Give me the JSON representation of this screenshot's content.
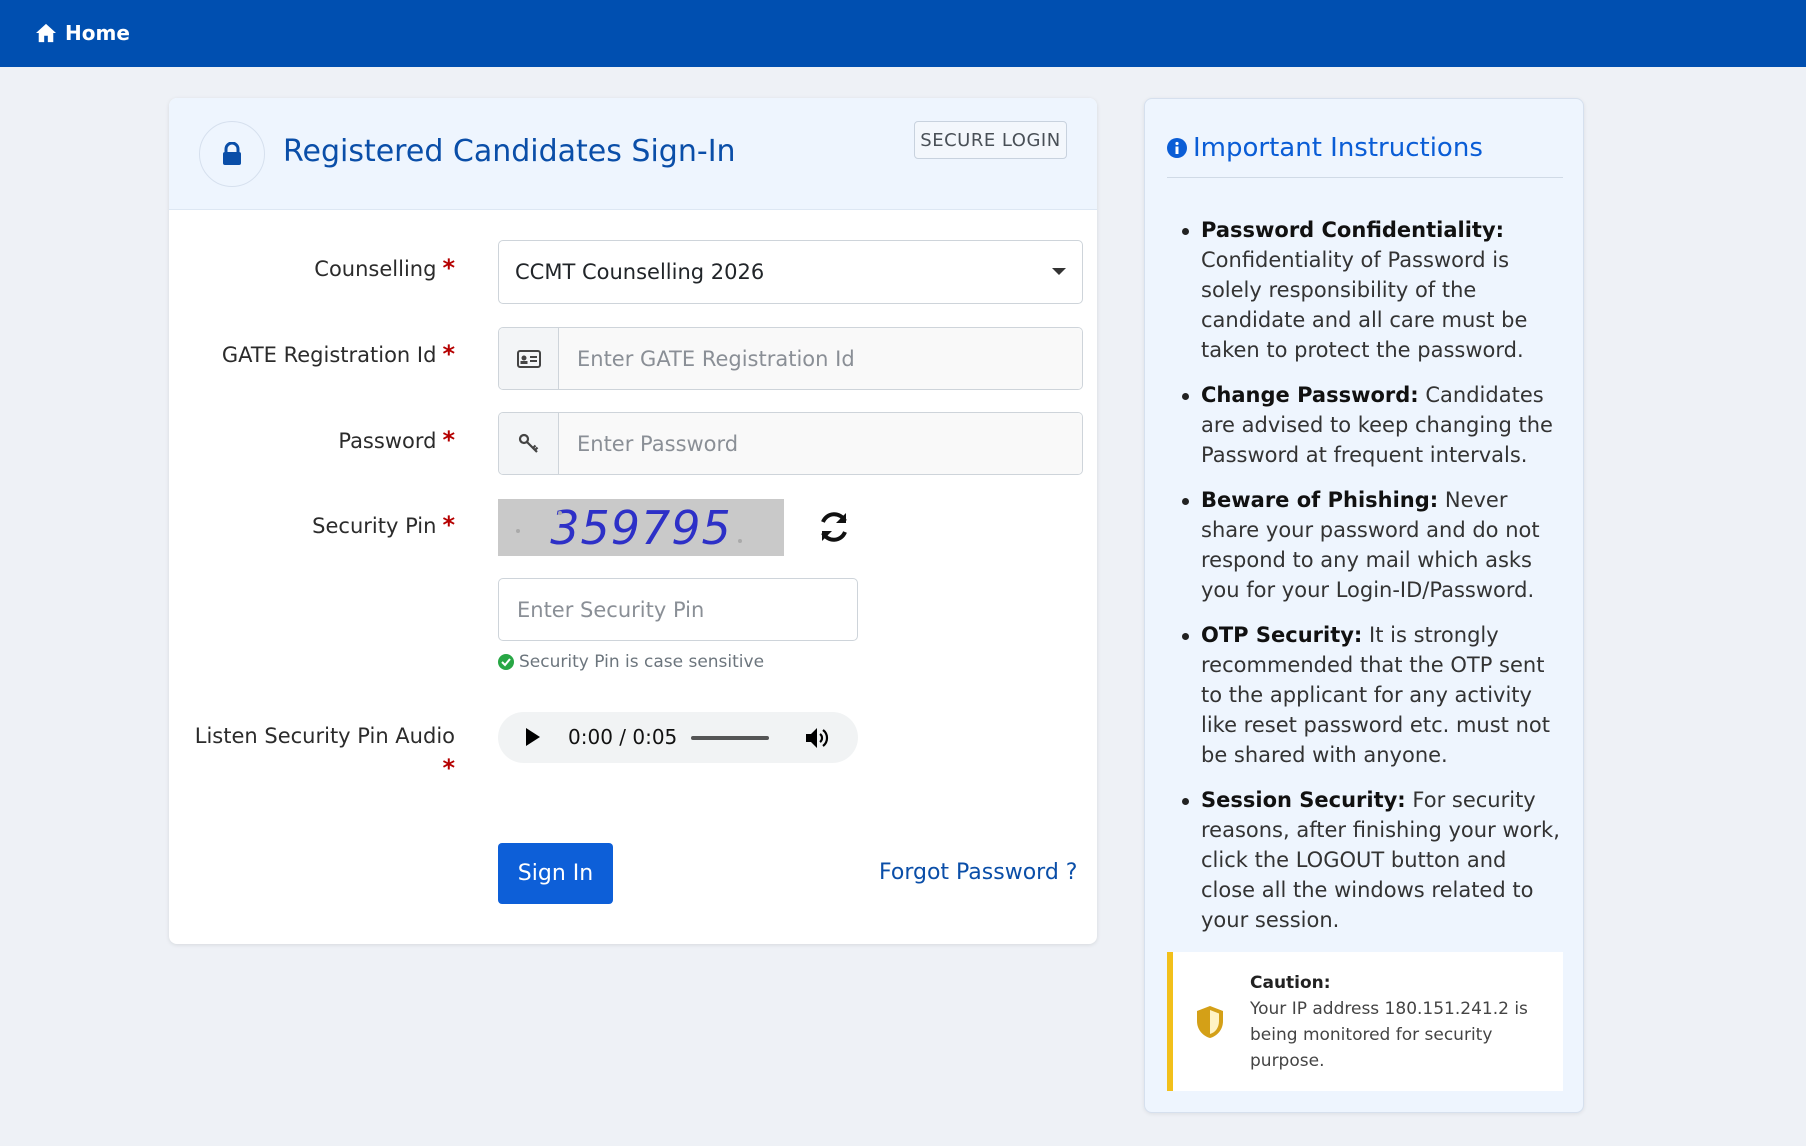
{
  "nav": {
    "home_label": "Home"
  },
  "login": {
    "title": "Registered Candidates Sign-In",
    "badge": "SECURE LOGIN",
    "counselling_label": "Counselling",
    "counselling_value": "CCMT Counselling 2026",
    "gate_label": "GATE Registration Id",
    "gate_placeholder": "Enter GATE Registration Id",
    "password_label": "Password",
    "password_placeholder": "Enter Password",
    "security_pin_label": "Security Pin",
    "captcha_text": "359795",
    "pin_placeholder": "Enter Security Pin",
    "pin_note": "Security Pin is case sensitive",
    "audio_label": "Listen Security Pin Audio",
    "audio_time": "0:00 / 0:05",
    "required_mark": "*",
    "sign_in_label": "Sign In",
    "forgot_label": "Forgot Password ?"
  },
  "instructions": {
    "title": "Important Instructions",
    "items": [
      {
        "heading": "Password Confidentiality:",
        "text": "Confidentiality of Password is solely responsibility of the candidate and all care must be taken to protect the password."
      },
      {
        "heading": "Change Password:",
        "text": "Candidates are advised to keep changing the Password at frequent intervals."
      },
      {
        "heading": "Beware of Phishing:",
        "text": "Never share your password and do not respond to any mail which asks you for your Login-ID/Password."
      },
      {
        "heading": "OTP Security:",
        "text": "It is strongly recommended that the OTP sent to the applicant for any activity like reset password etc. must not be shared with anyone."
      },
      {
        "heading": "Session Security:",
        "text": "For security reasons, after finishing your work, click the LOGOUT button and close all the windows related to your session."
      }
    ],
    "caution_heading": "Caution:",
    "caution_text": "Your IP address 180.151.241.2 is being monitored for security purpose."
  },
  "icons": {
    "home": "home-icon",
    "lock": "lock-icon",
    "id_card": "id-card-icon",
    "key": "key-icon",
    "refresh": "refresh-icon",
    "check": "check-circle-icon",
    "info": "info-circle-icon",
    "shield": "shield-icon"
  },
  "colors": {
    "brand": "#004fb0",
    "primary_button": "#0d5fd8",
    "required": "#b50000",
    "caution_accent": "#f2c01b"
  }
}
